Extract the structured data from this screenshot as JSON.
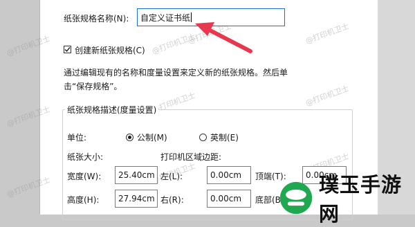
{
  "paper_name": {
    "label": "纸张规格名称(N):",
    "value": "自定义证书纸"
  },
  "create_new": {
    "label": "创建新纸张规格(C)",
    "checked": true
  },
  "description_text": {
    "line1": "通过编辑现有的名称和度量设置来定义新的纸张规格。然后单",
    "line2": "击“保存规格”。"
  },
  "group": {
    "title": "纸张规格描述(度量设置)",
    "unit_label": "单位:",
    "metric_label": "公制(M)",
    "metric_selected": true,
    "imperial_label": "英制(E)",
    "paper_size_label": "纸张大小:",
    "printer_margin_label": "打印机区域边距:",
    "width_label": "宽度(W):",
    "width_value": "25.40cm",
    "height_label": "高度(H):",
    "height_value": "27.94cm",
    "left_label": "左(L):",
    "left_value": "0.00cm",
    "right_label": "右(R):",
    "right_value": "0.00cm",
    "top_label": "顶端(T):",
    "top_value": "0.00cm",
    "bottom_label": "底部(B):"
  },
  "watermarks": [
    "@打印机卫士",
    "@打印机卫士",
    "@打印机卫士",
    "@打印机卫士",
    "@打印机卫士",
    "@打印机卫士",
    "@打印机卫士",
    "@打印机卫士",
    "@打印机卫士",
    "@打印机卫士"
  ],
  "brand": {
    "text": "璞玉手游网"
  },
  "colors": {
    "arrow": "#e8384f",
    "focus_border": "#1a6fd0",
    "brand_green": "#1fa84f"
  }
}
